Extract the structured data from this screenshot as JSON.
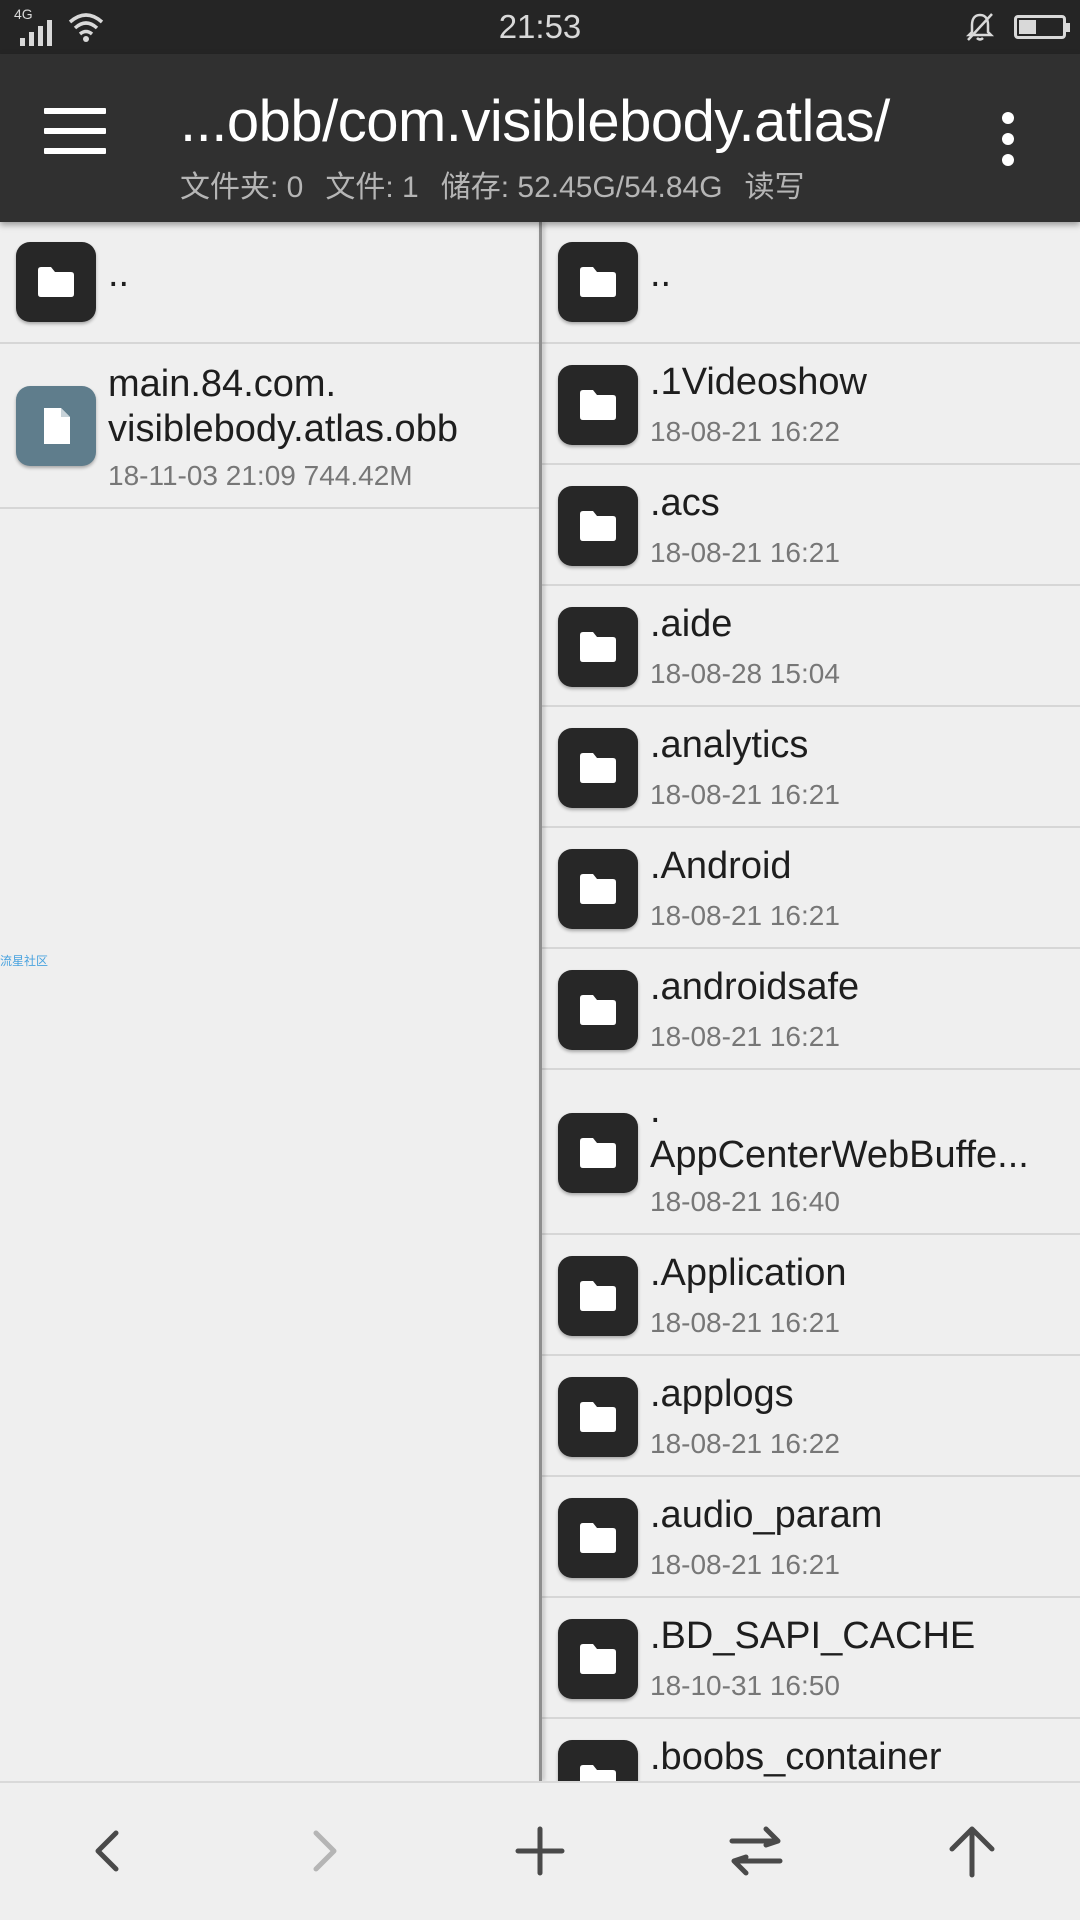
{
  "status_bar": {
    "network": "4G",
    "time": "21:53",
    "battery_level": 0.4
  },
  "toolbar": {
    "path": "...obb/com.visiblebody.atlas/",
    "folders": "文件夹: 0",
    "files": "文件: 1",
    "storage": "储存: 52.45G/54.84G",
    "mode": "读写"
  },
  "left_pane": {
    "parent": "..",
    "items": [
      {
        "name_line1": "main.84.com.",
        "name_line2": "visiblebody.atlas.obb",
        "meta": "18-11-03 21:09  744.42M"
      }
    ]
  },
  "right_pane": {
    "parent": "..",
    "items": [
      {
        "name": ".1Videoshow",
        "date": "18-08-21 16:22"
      },
      {
        "name": ".acs",
        "date": "18-08-21 16:21"
      },
      {
        "name": ".aide",
        "date": "18-08-28 15:04"
      },
      {
        "name": ".analytics",
        "date": "18-08-21 16:21"
      },
      {
        "name": ".Android",
        "date": "18-08-21 16:21"
      },
      {
        "name": ".androidsafe",
        "date": "18-08-21 16:21"
      },
      {
        "name_line1": ".",
        "name_line2": "AppCenterWebBuffe...",
        "date": "18-08-21 16:40"
      },
      {
        "name": ".Application",
        "date": "18-08-21 16:21"
      },
      {
        "name": ".applogs",
        "date": "18-08-21 16:22"
      },
      {
        "name": ".audio_param",
        "date": "18-08-21 16:21"
      },
      {
        "name": ".BD_SAPI_CACHE",
        "date": "18-10-31 16:50"
      },
      {
        "name": ".boobs_container",
        "date": ""
      }
    ]
  },
  "watermark": "流星社区",
  "icons": {
    "folder": "folder-icon",
    "file": "file-icon"
  }
}
